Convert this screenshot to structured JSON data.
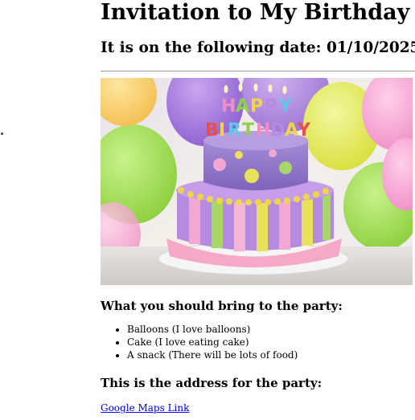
{
  "page": {
    "heading": "Invitation to My Birthday",
    "date_line": "It is on the following date: 01/10/2025",
    "image": {
      "subject": "birthday-cake-photo",
      "candle_letters": "HAPPY BIRTHDAY"
    },
    "bring_heading": "What you should bring to the party:",
    "bring_items": [
      "Balloons (I love balloons)",
      "Cake (I love eating cake)",
      "A snack (There will be lots of food)"
    ],
    "address_heading": "This is the address for the party:",
    "maps_link": "Google Maps Link"
  },
  "colors": {
    "link": "#0000ee",
    "rule": "#9a9a9a"
  }
}
